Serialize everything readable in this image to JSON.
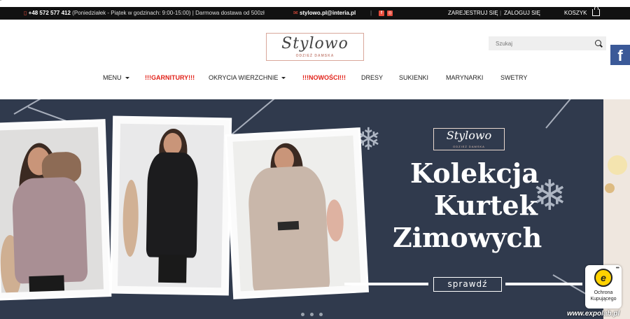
{
  "topbar": {
    "phone": "+48 572 577 412",
    "phone_note": "(Poniedziałek - Piątek w godzinach: 9:00-15:00) | Darmowa dostawa od 500zł",
    "email": "stylowo.pl@interia.pl",
    "register": "ZAREJESTRUJ SIĘ",
    "separator": "|",
    "login": "ZALOGUJ SIĘ",
    "cart": "KOSZYK"
  },
  "logo": {
    "script": "Stylowo",
    "sub": "ODZIEŻ DAMSKA"
  },
  "search": {
    "placeholder": "Szukaj"
  },
  "nav": {
    "items": [
      {
        "label": "MENU"
      },
      {
        "label": "!!!GARNITURY!!!"
      },
      {
        "label": "OKRYCIA WIERZCHNIE"
      },
      {
        "label": "!!!NOWOŚCI!!!"
      },
      {
        "label": "DRESY"
      },
      {
        "label": "SUKIENKI"
      },
      {
        "label": "MARYNARKI"
      },
      {
        "label": "SWETRY"
      }
    ]
  },
  "hero": {
    "logo_script": "Stylowo",
    "logo_sub": "ODZIEŻ DAMSKA",
    "headline": [
      "Kolekcja",
      "Kurtek",
      "Zimowych"
    ],
    "cta": "sprawdź"
  },
  "trust_badge": {
    "seal": "e",
    "line1": "Ochrona",
    "line2": "Kupującego"
  },
  "watermark": "www.expolab.pl",
  "colors": {
    "topbar_bg": "#111111",
    "nav_highlight": "#e2231a",
    "hero_bg": "#303a4d",
    "logo_accent": "#d9a79b",
    "facebook": "#3b5998"
  }
}
